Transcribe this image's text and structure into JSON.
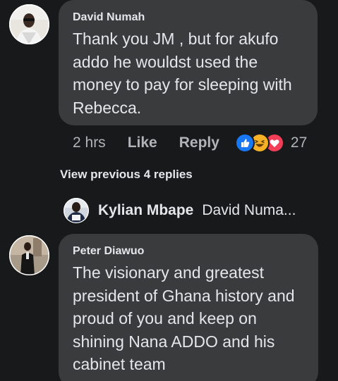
{
  "comments": [
    {
      "author": "David Numah",
      "text": "Thank you JM , but for akufo\naddo he wouldst used the\nmoney to pay for sleeping with\nRebecca.",
      "time": "2 hrs",
      "like_label": "Like",
      "reply_label": "Reply",
      "reactions": [
        "like-reaction",
        "haha-reaction",
        "love-reaction"
      ],
      "reaction_count": "27",
      "colors": {
        "like": "#1877f2",
        "haha": "#f7b125",
        "love": "#f33e58"
      }
    },
    {
      "author": "Peter Diawuo",
      "text": "The visionary and greatest\npresident of Ghana history and\nproud of you and keep on\nshining Nana ADDO and his\ncabinet team"
    }
  ],
  "view_previous_label": "View previous 4 replies",
  "reply_preview": {
    "author": "Kylian Mbape",
    "snippet": "David Numa..."
  },
  "theme": {
    "background": "#18191a",
    "bubble": "#3a3b3c",
    "text": "#e4e6eb",
    "muted": "#b0b3b8"
  }
}
